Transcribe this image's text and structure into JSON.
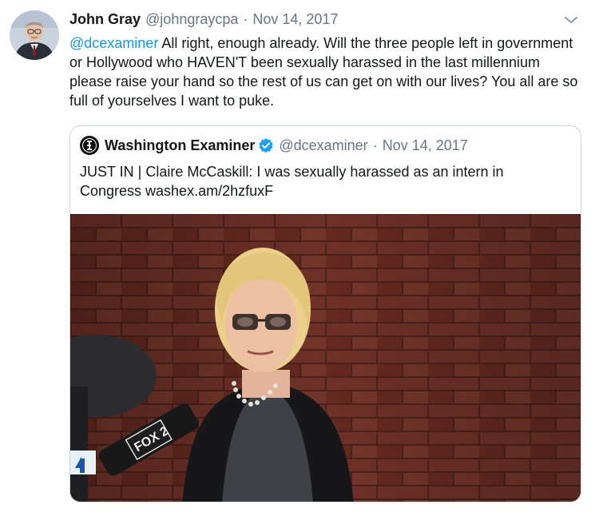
{
  "tweet": {
    "author_name": "John Gray",
    "author_handle": "@johngraycpa",
    "separator": "·",
    "date": "Nov 14, 2017",
    "reply_mention": "@dcexaminer",
    "text": " All right, enough  already. Will the three people left in government or Hollywood who HAVEN'T been sexually harassed in the last millennium please raise your hand so the rest of us can get on with our lives? You all are so full of yourselves I want to puke.",
    "menu_icon": "chevron-down-icon"
  },
  "quoted_tweet": {
    "author_name": "Washington Examiner",
    "author_handle": "@dcexaminer",
    "separator": "·",
    "date": "Nov 14, 2017",
    "verified": true,
    "text": "JUST IN | Claire McCaskill: I was sexually harassed as an intern in Congress washex.am/2hzfuxF",
    "image_microphone_label": "FOX 2"
  },
  "colors": {
    "text_primary": "#14171a",
    "text_secondary": "#657786",
    "link": "#1b95e0",
    "border": "#ccd6dd",
    "verified": "#1da1f2"
  }
}
